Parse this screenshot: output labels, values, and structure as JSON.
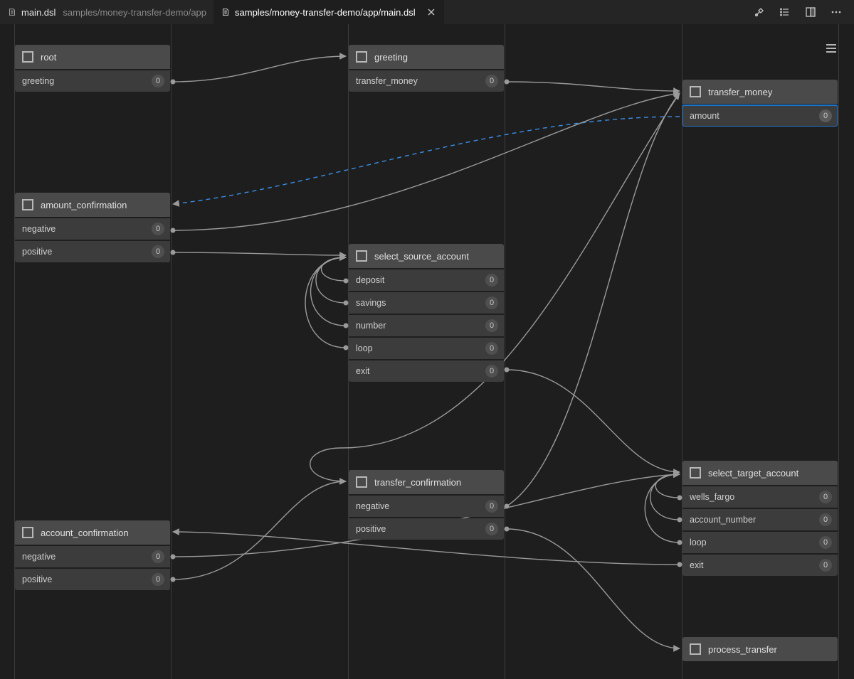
{
  "tabs": [
    {
      "name": "main.dsl",
      "path": "samples/money-transfer-demo/app",
      "active": false
    },
    {
      "name": "samples/money-transfer-demo/app/main.dsl",
      "path": "",
      "active": true
    }
  ],
  "nodes": {
    "root": {
      "title": "root",
      "rows": [
        {
          "label": "greeting",
          "badge": "0"
        }
      ]
    },
    "greeting": {
      "title": "greeting",
      "rows": [
        {
          "label": "transfer_money",
          "badge": "0"
        }
      ]
    },
    "transfer_money": {
      "title": "transfer_money",
      "rows": [
        {
          "label": "amount",
          "badge": "0",
          "selected": true
        }
      ]
    },
    "amount_confirmation": {
      "title": "amount_confirmation",
      "rows": [
        {
          "label": "negative",
          "badge": "0"
        },
        {
          "label": "positive",
          "badge": "0"
        }
      ]
    },
    "select_source_account": {
      "title": "select_source_account",
      "rows": [
        {
          "label": "deposit",
          "badge": "0"
        },
        {
          "label": "savings",
          "badge": "0"
        },
        {
          "label": "number",
          "badge": "0"
        },
        {
          "label": "loop",
          "badge": "0"
        },
        {
          "label": "exit",
          "badge": "0"
        }
      ]
    },
    "transfer_confirmation": {
      "title": "transfer_confirmation",
      "rows": [
        {
          "label": "negative",
          "badge": "0"
        },
        {
          "label": "positive",
          "badge": "0"
        }
      ]
    },
    "account_confirmation": {
      "title": "account_confirmation",
      "rows": [
        {
          "label": "negative",
          "badge": "0"
        },
        {
          "label": "positive",
          "badge": "0"
        }
      ]
    },
    "select_target_account": {
      "title": "select_target_account",
      "rows": [
        {
          "label": "wells_fargo",
          "badge": "0"
        },
        {
          "label": "account_number",
          "badge": "0"
        },
        {
          "label": "loop",
          "badge": "0"
        },
        {
          "label": "exit",
          "badge": "0"
        }
      ]
    },
    "process_transfer": {
      "title": "process_transfer",
      "rows": []
    }
  }
}
